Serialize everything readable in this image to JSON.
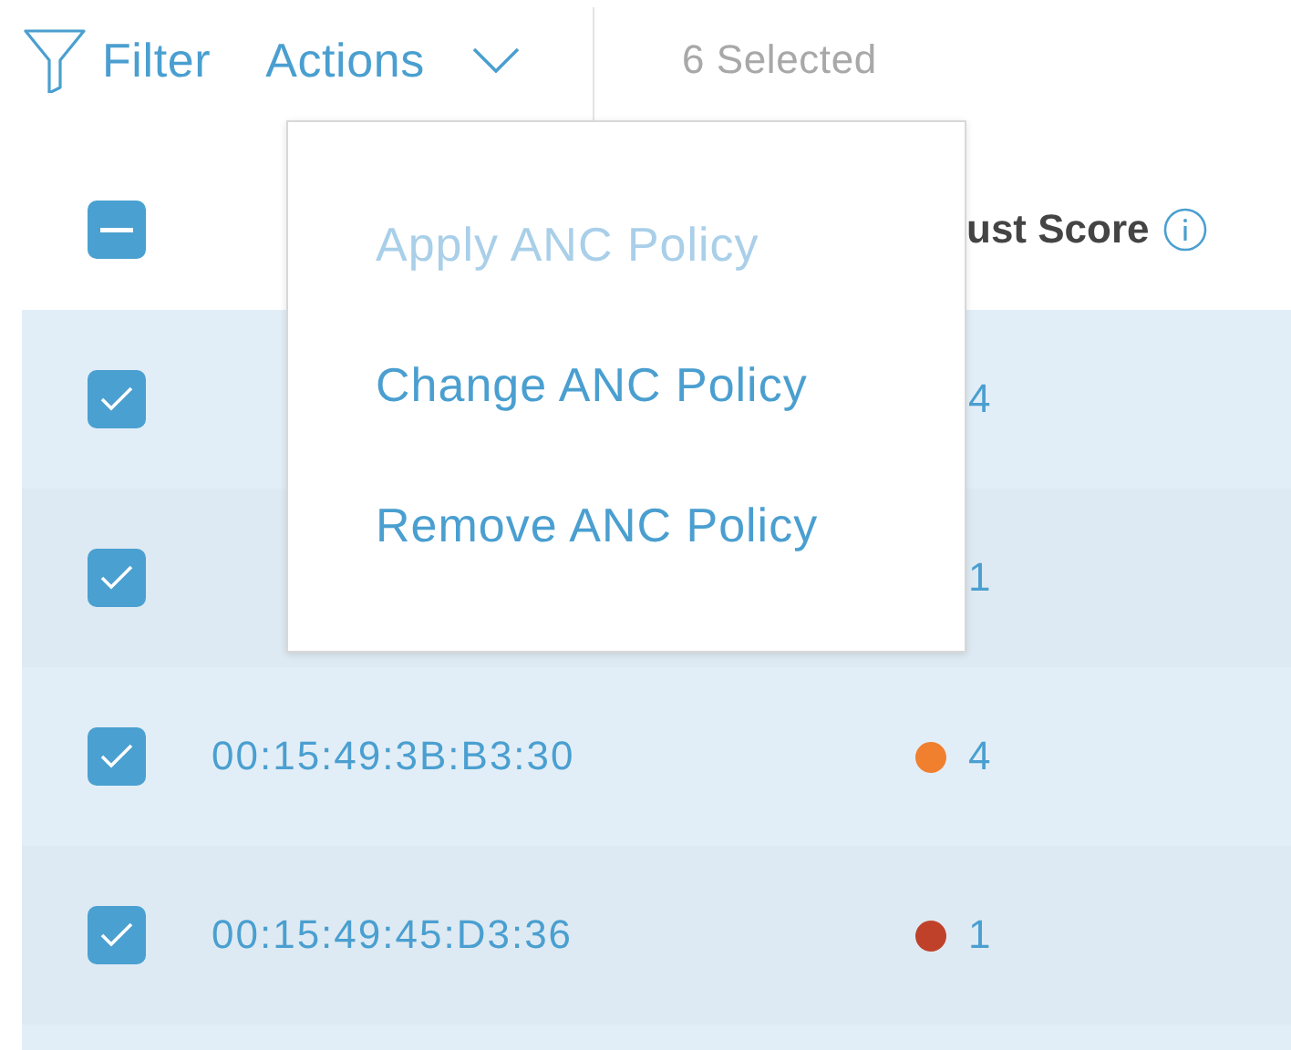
{
  "toolbar": {
    "filter_label": "Filter",
    "actions_label": "Actions",
    "selection_count": "6 Selected"
  },
  "actions_menu": {
    "items": [
      {
        "label": "Apply ANC Policy",
        "disabled": true
      },
      {
        "label": "Change ANC Policy",
        "disabled": false
      },
      {
        "label": "Remove ANC Policy",
        "disabled": false
      }
    ]
  },
  "table": {
    "header": {
      "indeterminate": true,
      "score_column": "ust Score"
    },
    "rows": [
      {
        "checked": true,
        "score": "4"
      },
      {
        "checked": true,
        "score": "1"
      },
      {
        "checked": true,
        "mac": "00:15:49:3B:B3:30",
        "score": "4",
        "color": "#f07f2e"
      },
      {
        "checked": true,
        "mac": "00:15:49:45:D3:36",
        "score": "1",
        "color": "#c0412a"
      }
    ]
  }
}
